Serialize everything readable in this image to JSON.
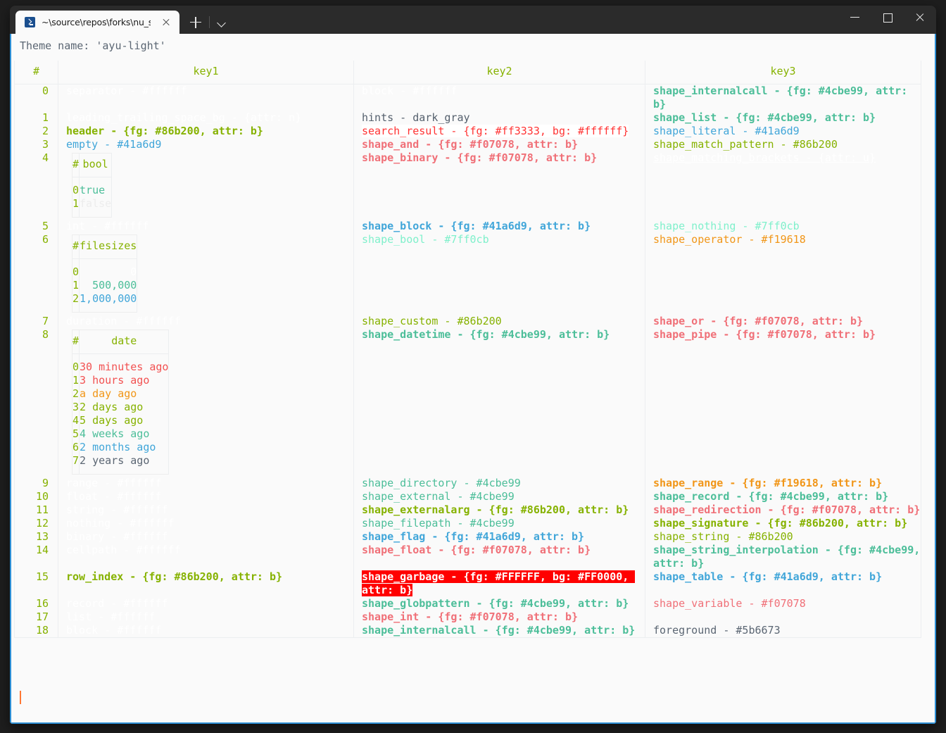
{
  "window": {
    "tab_title": "~\\source\\repos\\forks\\nu_scrip",
    "tab_icon": "powershell-icon",
    "new_tab_label": "+",
    "dropdown_label": "v",
    "minimize_label": "–",
    "maximize_label": "□",
    "close_label": "✕"
  },
  "terminal": {
    "theme_line": "Theme name: 'ayu-light'",
    "cursor_color": "#ff7733",
    "background": "#fafafa",
    "foreground": "#5b6673"
  },
  "palette": {
    "green": "#86b200",
    "white": "#ffffff",
    "teal": "#4cbe99",
    "blue": "#41a6d9",
    "red": "#f07078",
    "bright_red": "#ff3333",
    "orange": "#f19618",
    "mint": "#7ff0cb",
    "gray": "#5b6673",
    "dark_gray": "#55606d",
    "garbage_bg": "#ff0000"
  },
  "table": {
    "headers": [
      "#",
      "key1",
      "key2",
      "key3"
    ],
    "rows": [
      {
        "index": "0",
        "key1": [
          {
            "text": "separator - #ffffff",
            "color": "#ffffff"
          }
        ],
        "key2": [
          {
            "text": "block - #ffffff",
            "color": "#ffffff"
          }
        ],
        "key3": [
          {
            "text": "shape_internalcall - {fg: #4cbe99, attr: b}",
            "color": "#4cbe99",
            "bold": true
          }
        ]
      },
      {
        "index": "1",
        "key1": [
          {
            "text": "leading_trailing_space_bg - {attr: n}",
            "color": "#ffffff"
          }
        ],
        "key2": [
          {
            "text": "hints - dark_gray",
            "color": "#55606d"
          }
        ],
        "key3": [
          {
            "text": "shape_list - {fg: #4cbe99, attr: b}",
            "color": "#4cbe99",
            "bold": true
          }
        ]
      },
      {
        "index": "2",
        "key1": [
          {
            "text": "header - {fg: #86b200, attr: b}",
            "color": "#86b200",
            "bold": true
          }
        ],
        "key2": [
          {
            "text": "search_result - {fg: #ff3333, bg: #ffffff}",
            "color": "#ff3333",
            "bg": "#ffffff"
          }
        ],
        "key3": [
          {
            "text": "shape_literal - #41a6d9",
            "color": "#41a6d9"
          }
        ]
      },
      {
        "index": "3",
        "key1": [
          {
            "text": "empty - #41a6d9",
            "color": "#41a6d9"
          }
        ],
        "key2": [
          {
            "text": "shape_and - {fg: #f07078, attr: b}",
            "color": "#f07078",
            "bold": true
          }
        ],
        "key3": [
          {
            "text": "shape_match_pattern - #86b200",
            "color": "#86b200"
          }
        ]
      },
      {
        "index": "4",
        "key1": [
          {
            "subtable": "bool"
          }
        ],
        "key2": [
          {
            "text": "shape_binary - {fg: #f07078, attr: b}",
            "color": "#f07078",
            "bold": true
          }
        ],
        "key3": [
          {
            "text": "shape_matching_brackets - {attr: u}",
            "color": "#ffffff",
            "underline": true
          }
        ]
      },
      {
        "index": "5",
        "key1": [
          {
            "text": "int - #ffffff",
            "color": "#ffffff"
          }
        ],
        "key2": [
          {
            "text": "shape_block - {fg: #41a6d9, attr: b}",
            "color": "#41a6d9",
            "bold": true
          }
        ],
        "key3": [
          {
            "text": "shape_nothing - #7ff0cb",
            "color": "#7ff0cb"
          }
        ]
      },
      {
        "index": "6",
        "key1": [
          {
            "subtable": "filesizes"
          }
        ],
        "key2": [
          {
            "text": "shape_bool - #7ff0cb",
            "color": "#7ff0cb"
          }
        ],
        "key3": [
          {
            "text": "shape_operator - #f19618",
            "color": "#f19618"
          }
        ]
      },
      {
        "index": "7",
        "key1": [
          {
            "text": "duration - #ffffff",
            "color": "#ffffff"
          }
        ],
        "key2": [
          {
            "text": "shape_custom - #86b200",
            "color": "#86b200"
          }
        ],
        "key3": [
          {
            "text": "shape_or - {fg: #f07078, attr: b}",
            "color": "#f07078",
            "bold": true
          }
        ]
      },
      {
        "index": "8",
        "key1": [
          {
            "subtable": "date"
          }
        ],
        "key2": [
          {
            "text": "shape_datetime - {fg: #4cbe99, attr: b}",
            "color": "#4cbe99",
            "bold": true
          }
        ],
        "key3": [
          {
            "text": "shape_pipe - {fg: #f07078, attr: b}",
            "color": "#f07078",
            "bold": true
          }
        ]
      },
      {
        "index": "9",
        "key1": [
          {
            "text": "range - #ffffff",
            "color": "#ffffff"
          }
        ],
        "key2": [
          {
            "text": "shape_directory - #4cbe99",
            "color": "#4cbe99"
          }
        ],
        "key3": [
          {
            "text": "shape_range - {fg: #f19618, attr: b}",
            "color": "#f19618",
            "bold": true
          }
        ]
      },
      {
        "index": "10",
        "key1": [
          {
            "text": "float - #ffffff",
            "color": "#ffffff"
          }
        ],
        "key2": [
          {
            "text": "shape_external - #4cbe99",
            "color": "#4cbe99"
          }
        ],
        "key3": [
          {
            "text": "shape_record - {fg: #4cbe99, attr: b}",
            "color": "#4cbe99",
            "bold": true
          }
        ]
      },
      {
        "index": "11",
        "key1": [
          {
            "text": "string - #ffffff",
            "color": "#ffffff"
          }
        ],
        "key2": [
          {
            "text": "shape_externalarg - {fg: #86b200, attr: b}",
            "color": "#86b200",
            "bold": true
          }
        ],
        "key3": [
          {
            "text": "shape_redirection - {fg: #f07078, attr: b}",
            "color": "#f07078",
            "bold": true
          }
        ]
      },
      {
        "index": "12",
        "key1": [
          {
            "text": "nothing - #ffffff",
            "color": "#ffffff"
          }
        ],
        "key2": [
          {
            "text": "shape_filepath - #4cbe99",
            "color": "#4cbe99"
          }
        ],
        "key3": [
          {
            "text": "shape_signature - {fg: #86b200, attr: b}",
            "color": "#86b200",
            "bold": true
          }
        ]
      },
      {
        "index": "13",
        "key1": [
          {
            "text": "binary - #ffffff",
            "color": "#ffffff"
          }
        ],
        "key2": [
          {
            "text": "shape_flag - {fg: #41a6d9, attr: b}",
            "color": "#41a6d9",
            "bold": true
          }
        ],
        "key3": [
          {
            "text": "shape_string - #86b200",
            "color": "#86b200"
          }
        ]
      },
      {
        "index": "14",
        "key1": [
          {
            "text": "cellpath - #ffffff",
            "color": "#ffffff"
          }
        ],
        "key2": [
          {
            "text": "shape_float - {fg: #f07078, attr: b}",
            "color": "#f07078",
            "bold": true
          }
        ],
        "key3": [
          {
            "text": "shape_string_interpolation - {fg: #4cbe99, attr: b}",
            "color": "#4cbe99",
            "bold": true
          }
        ]
      },
      {
        "index": "15",
        "key1": [
          {
            "text": "row_index - {fg: #86b200, attr: b}",
            "color": "#86b200",
            "bold": true
          }
        ],
        "key2": [
          {
            "text": "shape_garbage - {fg: #FFFFFF, bg: #FF0000, attr: b}",
            "color": "#ffffff",
            "bg": "#ff0000",
            "bold": true
          }
        ],
        "key3": [
          {
            "text": "shape_table - {fg: #41a6d9, attr: b}",
            "color": "#41a6d9",
            "bold": true
          }
        ]
      },
      {
        "index": "16",
        "key1": [
          {
            "text": "record - #ffffff",
            "color": "#ffffff"
          }
        ],
        "key2": [
          {
            "text": "shape_globpattern - {fg: #4cbe99, attr: b}",
            "color": "#4cbe99",
            "bold": true
          }
        ],
        "key3": [
          {
            "text": "shape_variable - #f07078",
            "color": "#f07078"
          }
        ]
      },
      {
        "index": "17",
        "key1": [
          {
            "text": "list - #ffffff",
            "color": "#ffffff"
          }
        ],
        "key2": [
          {
            "text": "shape_int - {fg: #f07078, attr: b}",
            "color": "#f07078",
            "bold": true
          }
        ],
        "key3": [
          {
            "text": "",
            "color": "#5b6673"
          }
        ]
      },
      {
        "index": "18",
        "key1": [
          {
            "text": "block - #ffffff",
            "color": "#ffffff"
          }
        ],
        "key2": [
          {
            "text": "shape_internalcall - {fg: #4cbe99, attr: b}",
            "color": "#4cbe99",
            "bold": true
          }
        ],
        "key3": [
          {
            "text": "foreground - #5b6673",
            "color": "#5b6673"
          }
        ]
      }
    ]
  },
  "subtables": {
    "bool": {
      "headers": [
        "#",
        "bool"
      ],
      "rows": [
        {
          "idx": "0",
          "value": "true",
          "color": "#4cbe99"
        },
        {
          "idx": "1",
          "value": "false",
          "color": "#ededed"
        }
      ]
    },
    "filesizes": {
      "headers": [
        "#",
        "filesizes"
      ],
      "rows": [
        {
          "idx": "0",
          "value": "0",
          "color": "#ffffff"
        },
        {
          "idx": "1",
          "value": "500,000",
          "color": "#4cbe99"
        },
        {
          "idx": "2",
          "value": "1,000,000",
          "color": "#41a6d9"
        }
      ]
    },
    "date": {
      "headers": [
        "#",
        "date"
      ],
      "rows": [
        {
          "idx": "0",
          "value": "30 minutes ago",
          "color": "#f25151"
        },
        {
          "idx": "1",
          "value": "3 hours ago",
          "color": "#f25151"
        },
        {
          "idx": "2",
          "value": "a day ago",
          "color": "#f19618"
        },
        {
          "idx": "3",
          "value": "2 days ago",
          "color": "#86b200"
        },
        {
          "idx": "4",
          "value": "5 days ago",
          "color": "#86b200"
        },
        {
          "idx": "5",
          "value": "4 weeks ago",
          "color": "#4cbe99"
        },
        {
          "idx": "6",
          "value": "2 months ago",
          "color": "#41a6d9"
        },
        {
          "idx": "7",
          "value": "2 years ago",
          "color": "#5b6673"
        }
      ]
    }
  }
}
